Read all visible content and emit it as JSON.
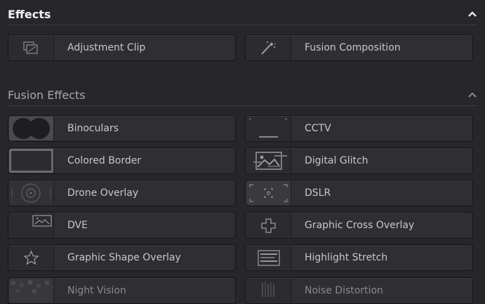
{
  "effects_section": {
    "title": "Effects",
    "items": [
      {
        "label": "Adjustment Clip",
        "icon": "adjustment-clip-icon"
      },
      {
        "label": "Fusion Composition",
        "icon": "magic-wand-icon"
      }
    ]
  },
  "fusion_effects_section": {
    "title": "Fusion Effects",
    "items": [
      {
        "label": "Binoculars",
        "icon": "binoculars-icon"
      },
      {
        "label": "CCTV",
        "icon": "cctv-icon"
      },
      {
        "label": "Colored Border",
        "icon": "colored-border-icon"
      },
      {
        "label": "Digital Glitch",
        "icon": "digital-glitch-icon"
      },
      {
        "label": "Drone Overlay",
        "icon": "drone-overlay-icon"
      },
      {
        "label": "DSLR",
        "icon": "dslr-icon"
      },
      {
        "label": "DVE",
        "icon": "dve-icon"
      },
      {
        "label": "Graphic Cross Overlay",
        "icon": "cross-icon"
      },
      {
        "label": "Graphic Shape Overlay",
        "icon": "star-icon"
      },
      {
        "label": "Highlight Stretch",
        "icon": "highlight-stretch-icon"
      },
      {
        "label": "Night Vision",
        "icon": "night-vision-icon"
      },
      {
        "label": "Noise Distortion",
        "icon": "noise-distortion-icon"
      }
    ]
  },
  "colors": {
    "background": "#27272b",
    "tile": "#2f2f33",
    "text": "#c8c8c8",
    "header_active": "#f2f2f2",
    "header_muted": "#a9a9ad"
  }
}
